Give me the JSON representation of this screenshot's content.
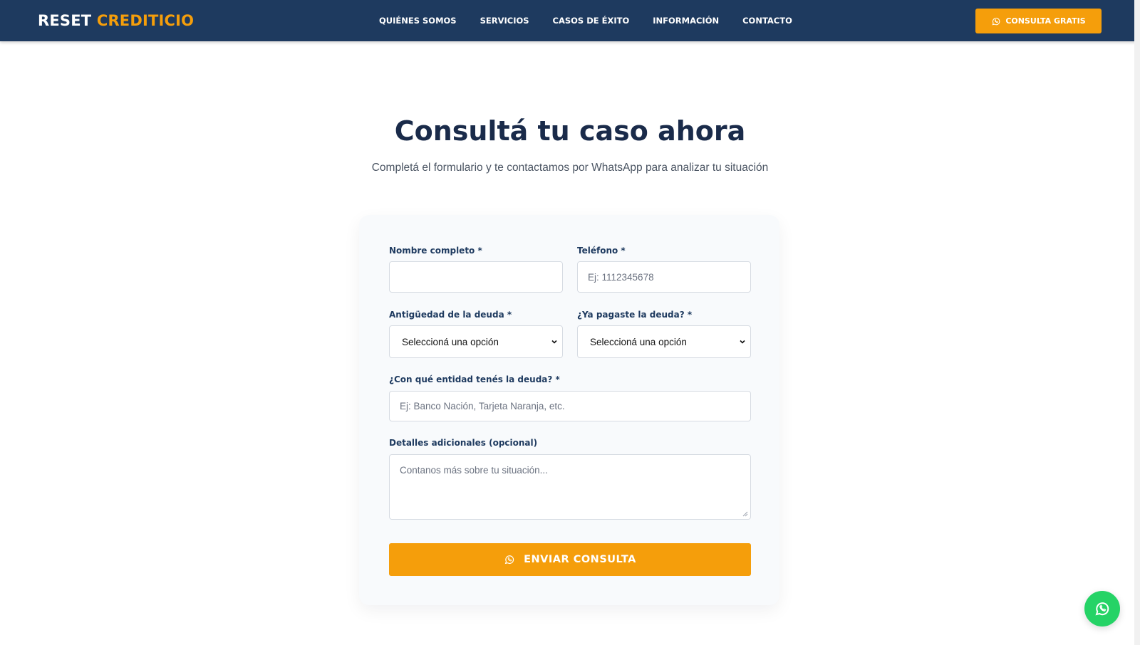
{
  "nav": {
    "logo_part1": "RESET ",
    "logo_part2": "CREDITICIO",
    "links": [
      "QUIÉNES SOMOS",
      "SERVICIOS",
      "CASOS DE ÉXITO",
      "INFORMACIÓN",
      "CONTACTO"
    ],
    "cta_label": "CONSULTA GRATIS"
  },
  "hero": {
    "title": "Consultá tu caso ahora",
    "subtitle": "Completá el formulario y te contactamos por WhatsApp para analizar tu situación"
  },
  "form": {
    "name_label": "Nombre completo *",
    "name_value": "",
    "phone_label": "Teléfono *",
    "phone_placeholder": "Ej: 1112345678",
    "age_label": "Antigüedad de la deuda *",
    "age_selected": "Seleccioná una opción",
    "paid_label": "¿Ya pagaste la deuda? *",
    "paid_selected": "Seleccioná una opción",
    "entity_label": "¿Con qué entidad tenés la deuda? *",
    "entity_placeholder": "Ej: Banco Nación, Tarjeta Naranja, etc.",
    "details_label": "Detalles adicionales (opcional)",
    "details_placeholder": "Contanos más sobre tu situación...",
    "submit_label": "ENVIAR CONSULTA"
  },
  "icons": {
    "cta": "whatsapp-icon",
    "submit": "whatsapp-icon",
    "fab": "whatsapp-icon",
    "select": "chevron-down-icon"
  },
  "colors": {
    "navbar": "#1e3a5f",
    "accent": "#f59e0b",
    "whatsapp_green": "#25d366",
    "heading": "#1a2b4a"
  }
}
